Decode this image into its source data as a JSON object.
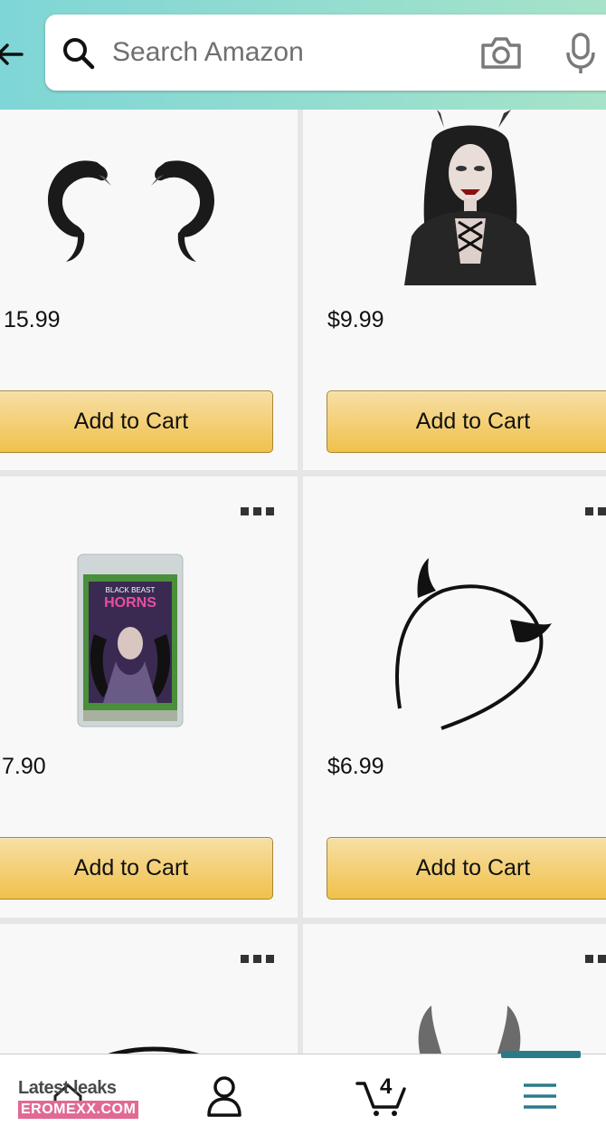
{
  "search": {
    "placeholder": "Search Amazon"
  },
  "products": [
    {
      "price": "15.99",
      "button_label": "Add to Cart"
    },
    {
      "price": "$9.99",
      "button_label": "Add to Cart"
    },
    {
      "price": "7.90",
      "button_label": "Add to Cart"
    },
    {
      "price": "$6.99",
      "button_label": "Add to Cart"
    }
  ],
  "package_text": {
    "line1": "BLACK BEAST",
    "line2": "HORNS"
  },
  "bottom_nav": {
    "cart_count": "4",
    "active_color": "#2a7b8a"
  },
  "watermark": {
    "line1": "Latest leaks",
    "line2": "EROMEXX.COM"
  },
  "colors": {
    "button_top": "#f7dfa5",
    "button_bottom": "#f0c14b",
    "header_left": "#7fd6d6",
    "header_right": "#a6e3c9"
  }
}
